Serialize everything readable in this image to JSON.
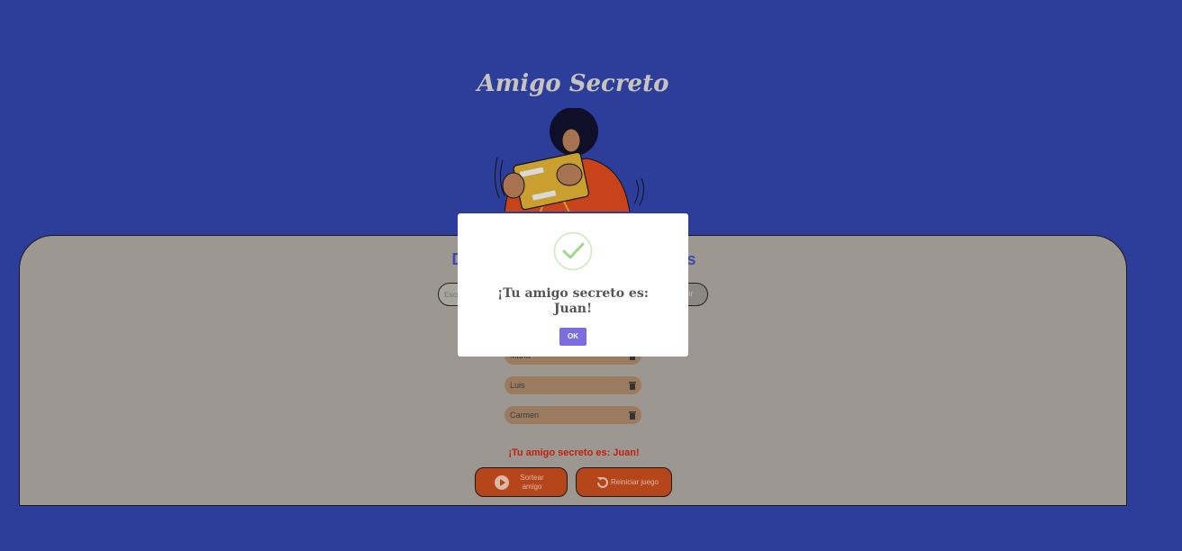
{
  "header": {
    "title": "Amigo Secreto"
  },
  "main": {
    "section_title": "Digite el nombre de sus amigos",
    "input": {
      "value": "",
      "placeholder": "Escribe un nombre"
    },
    "add_button_label": "Añadir",
    "friends": [
      "Maria",
      "Luis",
      "Carmen"
    ],
    "result_text": "¡Tu amigo secreto es: Juan!",
    "draw_button_label": "Sortear amigo",
    "reset_button_label": "Reiniciar juego"
  },
  "modal": {
    "line1": "¡Tu amigo secreto es:",
    "line2": "Juan!",
    "ok_label": "OK"
  },
  "colors": {
    "background": "#2d3d9a",
    "panel": "#9c9891",
    "accent": "#b5461c",
    "result": "#c11f0f",
    "ok_button": "#7d6ee0"
  }
}
